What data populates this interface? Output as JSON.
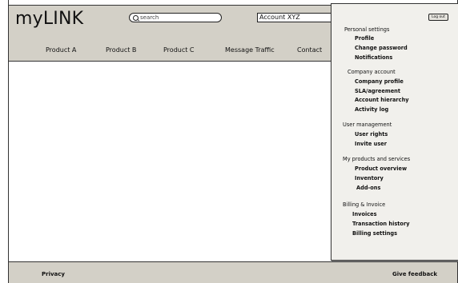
{
  "header": {
    "logo": "myLINK",
    "search_placeholder": "search",
    "account": "Account XYZ"
  },
  "nav": {
    "items": [
      "Product A",
      "Product B",
      "Product C",
      "Message Traffic",
      "Contact"
    ]
  },
  "user_menu": {
    "logout_label": "Log out",
    "personal_settings": {
      "title": "Personal settings",
      "items": [
        "Profile",
        "Change password",
        "Notifications"
      ]
    },
    "company_account": {
      "title": "Company account",
      "items": [
        "Company profile",
        "SLA/agreement",
        "Account hierarchy",
        "Activity log"
      ]
    },
    "user_management": {
      "title": "User management",
      "items": [
        "User rights",
        "Invite user"
      ]
    },
    "products_services": {
      "title": "My products and services",
      "items": [
        "Product overview",
        "Inventory",
        "Add-ons"
      ]
    },
    "billing": {
      "title": "Billing & Invoice",
      "items": [
        "Invoices",
        "Transaction history",
        "Billing settings"
      ]
    }
  },
  "footer": {
    "privacy": "Privacy",
    "feedback": "Give feedback"
  },
  "colors": {
    "chrome": "#d3d0c7",
    "menu_bg": "#f1f0ec",
    "border": "#333333"
  }
}
